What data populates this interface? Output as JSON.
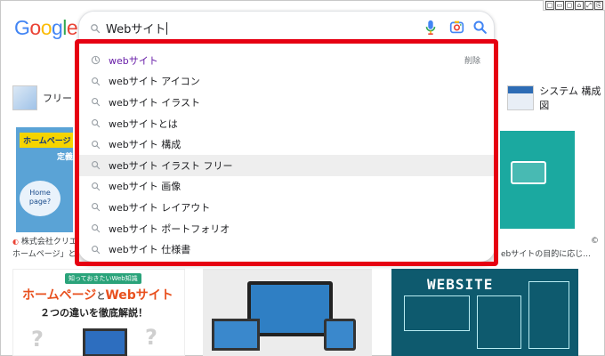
{
  "window_controls": [
    "□",
    "▭",
    "▢",
    "⌂",
    "⤢",
    "⎘"
  ],
  "logo": {
    "letters": [
      {
        "ch": "G",
        "color": "#4285F4"
      },
      {
        "ch": "o",
        "color": "#EA4335"
      },
      {
        "ch": "o",
        "color": "#FBBC05"
      },
      {
        "ch": "g",
        "color": "#4285F4"
      },
      {
        "ch": "l",
        "color": "#34A853"
      },
      {
        "ch": "e",
        "color": "#EA4335"
      }
    ]
  },
  "search": {
    "query": "Webサイト",
    "icons": {
      "search": "search-icon",
      "mic": "microphone-icon",
      "lens": "camera-lens-icon",
      "submit": "search-button-icon"
    }
  },
  "suggestions": [
    {
      "text": "webサイト",
      "type": "history",
      "remove_label": "削除",
      "icon": "history-clock-icon"
    },
    {
      "text": "webサイト アイコン",
      "type": "suggest",
      "icon": "search-icon"
    },
    {
      "text": "webサイト イラスト",
      "type": "suggest",
      "icon": "search-icon"
    },
    {
      "text": "webサイトとは",
      "type": "suggest",
      "icon": "search-icon"
    },
    {
      "text": "webサイト 構成",
      "type": "suggest",
      "icon": "search-icon"
    },
    {
      "text": "webサイト イラスト フリー",
      "type": "suggest",
      "icon": "search-icon",
      "hover": true
    },
    {
      "text": "webサイト 画像",
      "type": "suggest",
      "icon": "search-icon"
    },
    {
      "text": "webサイト レイアウト",
      "type": "suggest",
      "icon": "search-icon"
    },
    {
      "text": "webサイト ポートフォリオ",
      "type": "suggest",
      "icon": "search-icon"
    },
    {
      "text": "webサイト 仕様書",
      "type": "suggest",
      "icon": "search-icon"
    }
  ],
  "background": {
    "chip_left": "フリー",
    "chip_right": "システム 構成 図",
    "card1": {
      "ribbon": "ホームページ",
      "heading": "定義",
      "bubble_line1": "Home",
      "bubble_line2": "page?"
    },
    "caption_left_line1": "株式会社クリエ",
    "caption_left_line2": "ホームページ」と",
    "caption_right": "ebサイトの目的に応じ...",
    "caption_edge": "©",
    "bottom1": {
      "tag": "知っておきたいWeb知識",
      "headline_a": "ホームページ",
      "headline_and": "と",
      "headline_b": "Webサイト",
      "subline": "２つの違いを徹底解説！",
      "q": "?"
    },
    "bottom3": {
      "title": "WEBSITE"
    }
  },
  "colors": {
    "highlight_border": "#e60012",
    "history_text": "#681da8"
  }
}
